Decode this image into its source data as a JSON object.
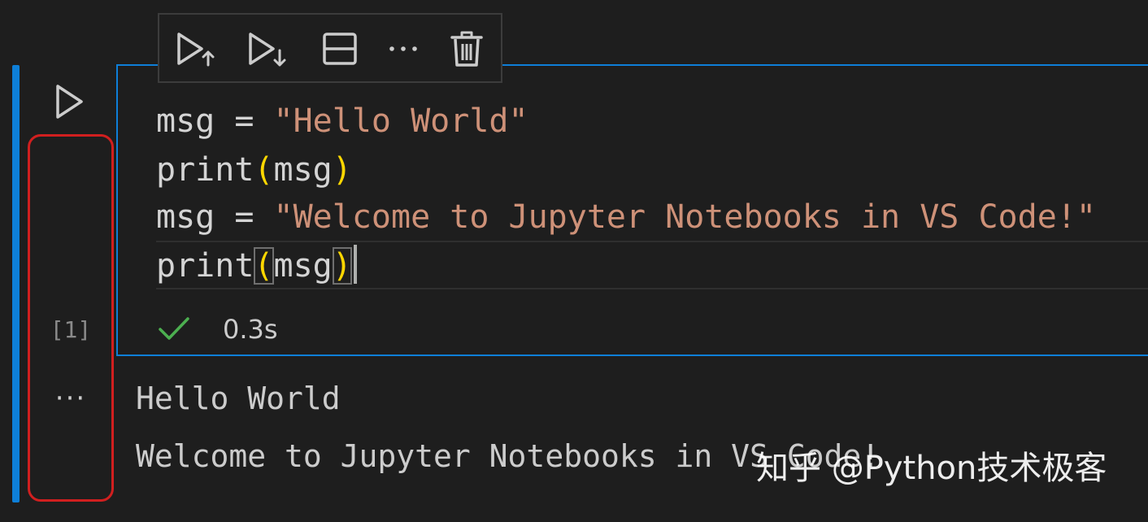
{
  "toolbar": {
    "buttons": [
      {
        "icon": "run-above-icon"
      },
      {
        "icon": "run-below-icon"
      },
      {
        "icon": "split-cell-icon"
      },
      {
        "icon": "more-actions-icon",
        "glyph": "···"
      },
      {
        "icon": "delete-icon"
      }
    ]
  },
  "cell": {
    "execution_count": "[1]",
    "code_lines": [
      {
        "pre": "msg = ",
        "str": "\"Hello World\""
      },
      {
        "fn": "print",
        "open": "(",
        "arg": "msg",
        "close": ")"
      },
      {
        "pre": "msg = ",
        "str": "\"Welcome to Jupyter Notebooks in VS Code!\""
      },
      {
        "fn": "print",
        "open": "(",
        "arg": "msg",
        "close": ")"
      }
    ],
    "status": {
      "icon": "check-icon",
      "duration": "0.3s"
    },
    "more_output_glyph": "···"
  },
  "output": {
    "lines": [
      "Hello World",
      "Welcome to Jupyter Notebooks in VS Code!"
    ]
  },
  "watermark": "知乎 @Python技术极客",
  "colors": {
    "accent": "#0e7fd8",
    "string": "#ce9178",
    "bracket": "#ffd700",
    "success": "#4caf50",
    "annotation": "#d11f1f",
    "background": "#1e1e1e"
  }
}
